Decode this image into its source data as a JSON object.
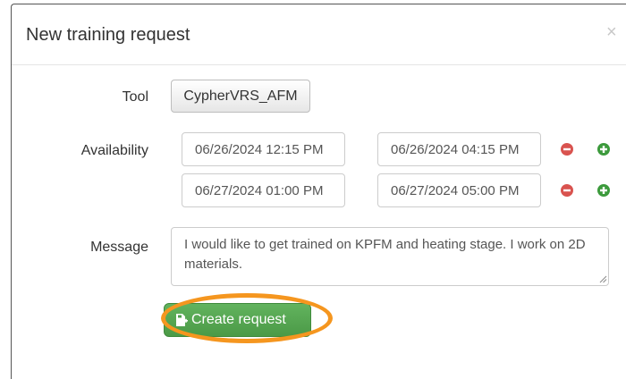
{
  "modal": {
    "title": "New training request",
    "close_label": "×"
  },
  "form": {
    "tool_label": "Tool",
    "tool_value": "CypherVRS_AFM",
    "availability_label": "Availability",
    "availability": [
      {
        "start": "06/26/2024 12:15 PM",
        "end": "06/26/2024 04:15 PM"
      },
      {
        "start": "06/27/2024 01:00 PM",
        "end": "06/27/2024 05:00 PM"
      }
    ],
    "message_label": "Message",
    "message_value": "I would like to get trained on KPFM and heating stage. I work on 2D materials.",
    "submit_label": "Create request"
  },
  "colors": {
    "remove": "#d9534f",
    "add": "#3c9a3c",
    "submit": "#5aa957",
    "highlight": "#f5961f"
  },
  "icons": {
    "remove": "minus-circle-icon",
    "add": "plus-circle-icon",
    "submit": "save-file-icon"
  }
}
